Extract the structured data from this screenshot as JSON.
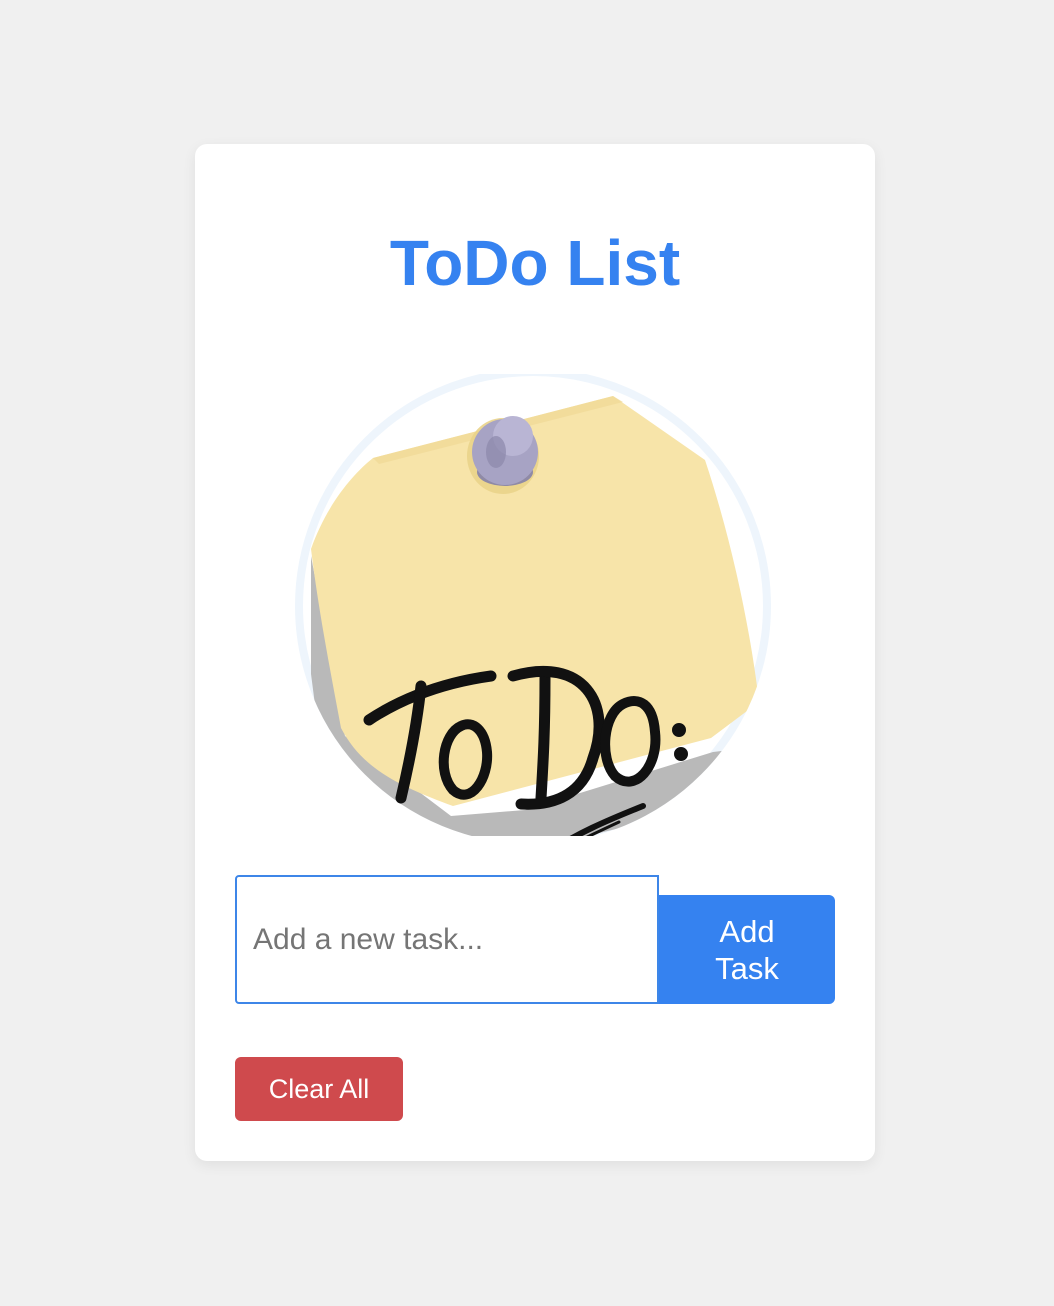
{
  "app": {
    "title": "ToDo List"
  },
  "hero": {
    "image_label": "To Do:",
    "icon": "sticky-note-todo",
    "colors": {
      "note": "#f7e4a9",
      "pin": "#a7a3c4",
      "ring": "#eef5fc"
    }
  },
  "task_form": {
    "input_value": "",
    "input_placeholder": "Add a new task...",
    "add_label": "Add Task"
  },
  "actions": {
    "clear_label": "Clear All"
  },
  "theme": {
    "accent": "#3582f0",
    "danger": "#cf4a4d",
    "background": "#f0f0f0",
    "card": "#ffffff"
  }
}
